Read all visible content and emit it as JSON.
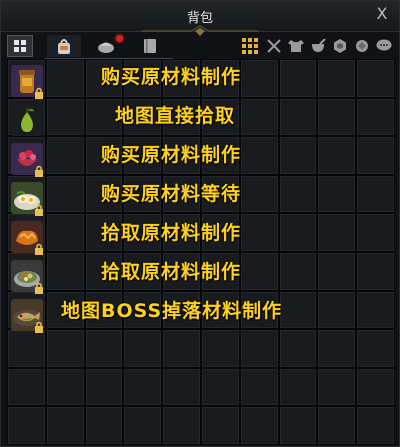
{
  "window": {
    "title": "背包",
    "close_symbol": "X"
  },
  "tabs": [
    {
      "name": "all-items",
      "icon": "grid-icon",
      "active": true
    },
    {
      "name": "bag",
      "icon": "bag-icon",
      "active": false
    },
    {
      "name": "food",
      "icon": "food-icon",
      "active": false,
      "notification": true
    },
    {
      "name": "book",
      "icon": "book-icon",
      "active": false
    }
  ],
  "toolbar_icons": [
    "grid-view-icon",
    "crossed-swords-icon",
    "armor-icon",
    "pot-icon",
    "hex-icon",
    "gem-icon",
    "chat-icon"
  ],
  "items": [
    {
      "icon": "jar-icon",
      "label": "购买原材料制作",
      "locked": true
    },
    {
      "icon": "pear-icon",
      "label": "地图直接拾取",
      "locked": false
    },
    {
      "icon": "berry-bowl-icon",
      "label": "购买原材料制作",
      "locked": true
    },
    {
      "icon": "egg-plate-icon",
      "label": "购买原材料等待",
      "locked": true
    },
    {
      "icon": "fried-food-icon",
      "label": "拾取原材料制作",
      "locked": true
    },
    {
      "icon": "salad-plate-icon",
      "label": "拾取原材料制作",
      "locked": true
    },
    {
      "icon": "fish-plate-icon",
      "label": "地图BOSS掉落材料制作",
      "locked": true
    }
  ],
  "colors": {
    "label": "#ffd21a",
    "notification": "#e21d1d",
    "background": "#101215"
  }
}
